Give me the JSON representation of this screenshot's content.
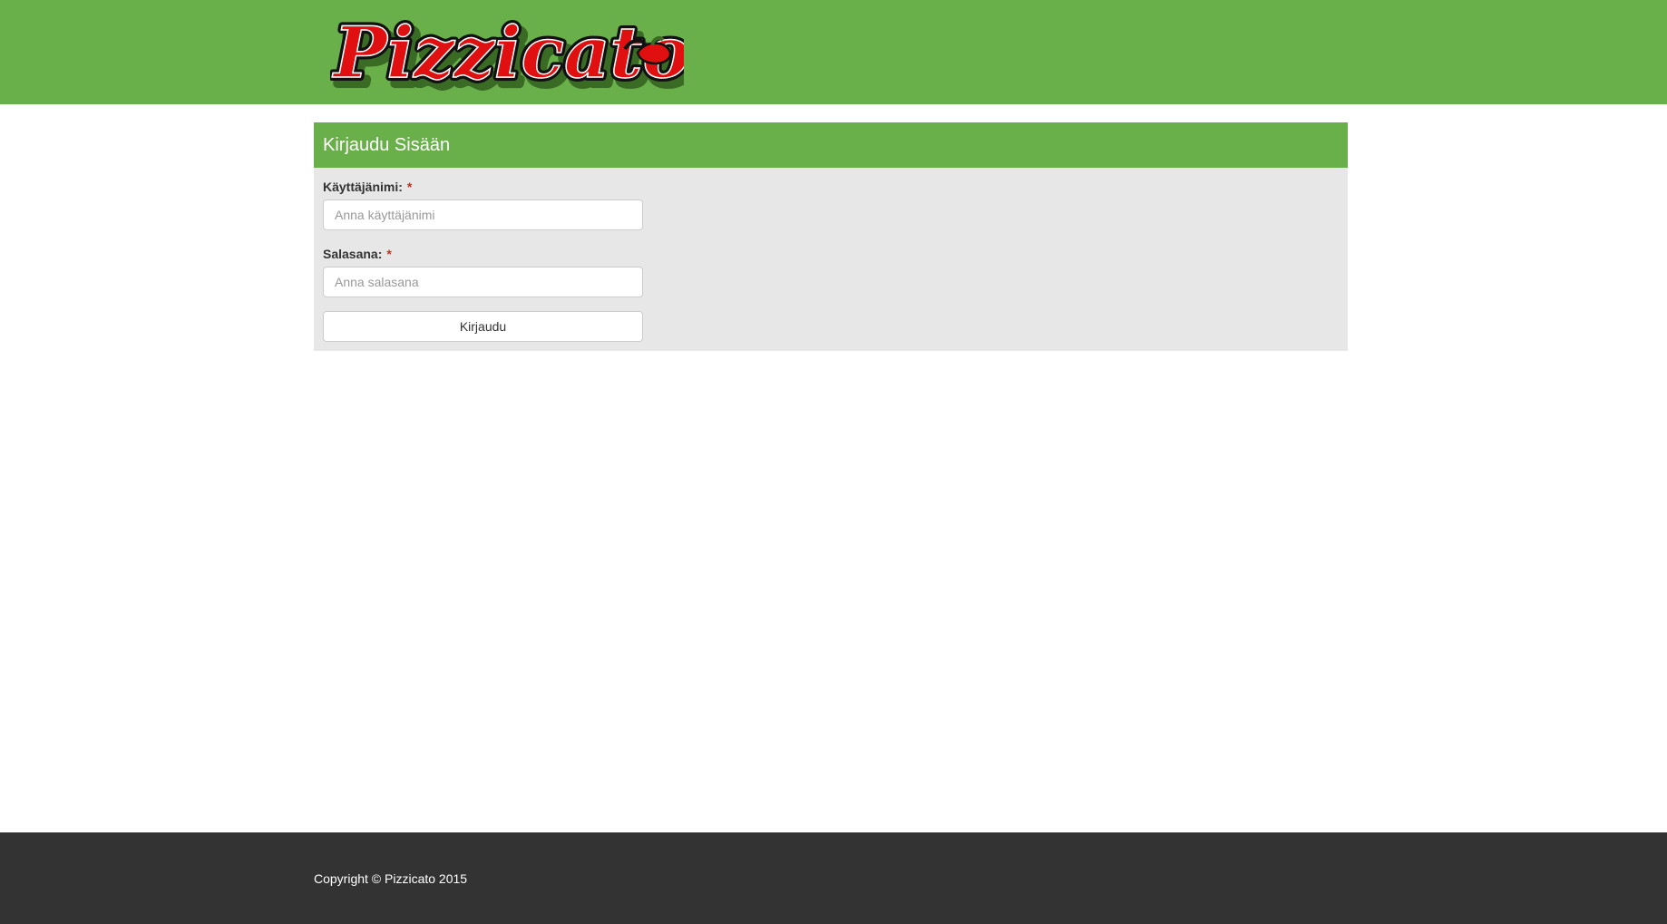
{
  "brand": {
    "logo_text": "Pizzicato",
    "header_color": "#6ab04a",
    "logo_red": "#e01010",
    "logo_shadow": "#3a6b25"
  },
  "login": {
    "title": "Kirjaudu Sisään",
    "username_label": "Käyttäjänimi:",
    "username_placeholder": "Anna käyttäjänimi",
    "username_value": "",
    "password_label": "Salasana:",
    "password_placeholder": "Anna salasana",
    "password_value": "",
    "required_marker": "*",
    "submit_label": "Kirjaudu"
  },
  "footer": {
    "copyright": "Copyright © Pizzicato 2015",
    "background": "#333333"
  }
}
